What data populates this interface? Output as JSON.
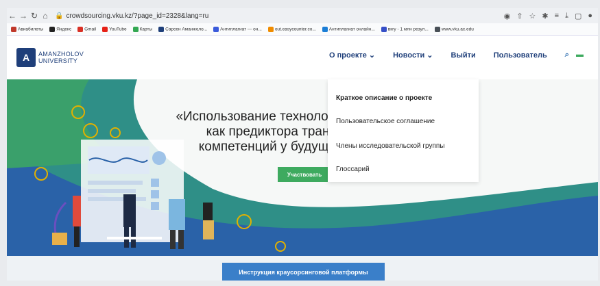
{
  "browser": {
    "url": "crowdsourcing.vku.kz/?page_id=2328&lang=ru",
    "bookmarks": [
      "Авиабилеты",
      "Яндекс",
      "Gmail",
      "YouTube",
      "Карты",
      "Сарсен Аманжоло...",
      "Антиплагиат — он...",
      "out.easycounter.co...",
      "Антиплагиат онлайн...",
      "вкгу - 1 млн резул...",
      "www.vku.ac.edu"
    ]
  },
  "header": {
    "logo_line1": "AMANZHOLOV",
    "logo_line2": "UNIVERSITY",
    "menu": {
      "about": "О проекте",
      "news": "Новости",
      "logout": "Выйти",
      "user": "Пользователь"
    }
  },
  "hero": {
    "line1": "«Использование технолоː",
    "line2": "как предиктора транс",
    "line3": "компетенций у будущи",
    "participate": "Участвовать"
  },
  "dropdown": {
    "items": [
      "Краткое описание о проекте",
      "Пользовательское соглашение",
      "Члены исследовательской группы",
      "Глоссарий"
    ]
  },
  "footer": {
    "instruction": "Инструкция краусорсинговой платформы"
  }
}
